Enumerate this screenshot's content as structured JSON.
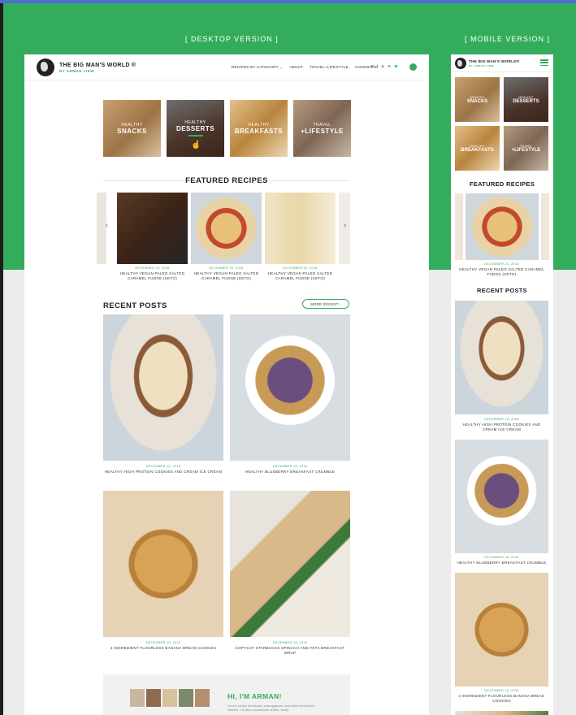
{
  "labels": {
    "desktop": "[ DESKTOP VERSION ]",
    "mobile": "[ MOBILE VERSION ]"
  },
  "brand": {
    "title": "THE BIG MAN'S WORLD ®",
    "subtitle": "BY ARMAN LIEW",
    "mobile_title": "THE BIG MAN'S WORLD®",
    "mobile_subtitle": "BY ARMAN LIEW"
  },
  "nav": {
    "items": [
      "RECIPES BY CATEGORY ⌄",
      "ABOUT",
      "TRAVEL+LIFESTYLE",
      "COOKBOOK"
    ],
    "socials": [
      "P",
      "f",
      "◎",
      "✉",
      "🐦"
    ]
  },
  "categories": [
    {
      "line1": "HEALTHY",
      "line2": "SNACKS"
    },
    {
      "line1": "HEALTHY",
      "line2": "DESSERTS"
    },
    {
      "line1": "HEALTHY",
      "line2": "BREAKFASTS"
    },
    {
      "line1": "TRAVEL",
      "line2": "+LIFESTYLE"
    }
  ],
  "featured": {
    "title": "FEATURED RECIPES",
    "items": [
      {
        "date": "DECEMBER 20, 2018",
        "title": "HEALTHY VEGAN PALEO SALTED CARAMEL FUDGE (KETO)"
      },
      {
        "date": "DECEMBER 20, 2018",
        "title": "HEALTHY VEGAN PALEO SALTED CARAMEL FUDGE (KETO)"
      },
      {
        "date": "DECEMBER 20, 2018",
        "title": "HEALTHY VEGAN PALEO SALTED CARAMEL FUDGE (KETO)"
      }
    ],
    "arrow_prev": "‹",
    "arrow_next": "›"
  },
  "recent": {
    "title": "RECENT POSTS",
    "more_button": "MORE RECENT ›",
    "posts": [
      {
        "date": "DECEMBER 18, 2018",
        "title": "HEALTHY HIGH PROTEIN COOKIES AND CREAM ICE CREAM"
      },
      {
        "date": "DECEMBER 18, 2018",
        "title": "HEALTHY BLUEBERRY BREAKFAST CRUMBLE"
      },
      {
        "date": "DECEMBER 18, 2018",
        "title": "3 INGREDIENT FLOURLESS BANANA BREAD COOKIES"
      },
      {
        "date": "DECEMBER 18, 2018",
        "title": "COPYCAT STARBUCKS SPINACH AND FETA BREAKFAST WRAP"
      }
    ]
  },
  "about": {
    "title": "HI, I'M ARMAN!",
    "text": "I'm the recipe developer, photographer, and writer behind the website. I'm also a cookbook author, foody"
  },
  "mobile": {
    "featured_title": "FEATURED RECIPES",
    "featured_date": "DECEMBER 20, 2018",
    "featured_item": "HEALTHY VEGAN PALEO SALTED CARAMEL FUDGE (KETO)",
    "recent_title": "RECENT POSTS",
    "posts": [
      {
        "date": "DECEMBER 18, 2018",
        "title": "HEALTHY HIGH PROTEIN COOKIES AND CREAM ICE CREAM"
      },
      {
        "date": "DECEMBER 18, 2018",
        "title": "HEALTHY BLUEBERRY BREAKFAST CRUMBLE"
      },
      {
        "date": "DECEMBER 18, 2018",
        "title": "3 INGREDIENT FLOURLESS BANANA BREAD COOKIES"
      }
    ]
  },
  "colors": {
    "brand_green": "#33ad5c",
    "background": "#ececec"
  }
}
